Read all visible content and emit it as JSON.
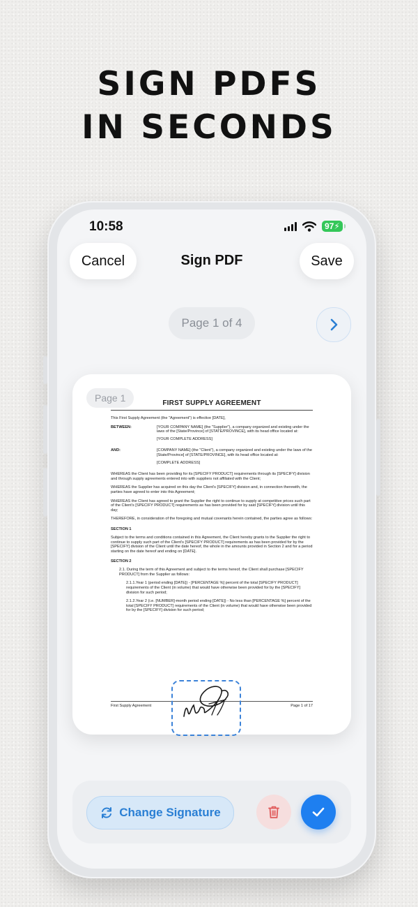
{
  "headline": {
    "line1": "SIGN PDFS",
    "line2": "IN SECONDS"
  },
  "status_bar": {
    "time": "10:58",
    "battery": "97"
  },
  "nav": {
    "cancel": "Cancel",
    "title": "Sign PDF",
    "save": "Save"
  },
  "pager": {
    "indicator": "Page 1 of 4"
  },
  "document": {
    "page_chip": "Page 1",
    "title": "FIRST SUPPLY AGREEMENT",
    "intro": "This First Supply Agreement (the \"Agreement\") is effective [DATE],",
    "between_label": "BETWEEN:",
    "between_text": "[YOUR COMPANY NAME] (the \"Supplier\"), a company organized and existing under the laws of the [State/Province] of [STATE/PROVINCE], with its head office located at:",
    "between_addr": "[YOUR COMPLETE ADDRESS]",
    "and_label": "AND:",
    "and_text": "[COMPANY NAME] (the \"Client\"), a company organized and existing under the laws of the [State/Province] of [STATE/PROVINCE], with its head office located at:",
    "and_addr": "[COMPLETE ADDRESS]",
    "whereas1": "WHEREAS the Client has been providing for its [SPECIFY PRODUCT] requirements through its [SPECIFY] division and through supply agreements entered into with suppliers not affiliated with the Client;",
    "whereas2": "WHEREAS the Supplier has acquired on this day the Client's [SPECIFY] division and, in connection therewith, the parties have agreed to enter into this Agreement;",
    "whereas3": "WHEREAS the Client has agreed to grant the Supplier the right to continue to supply at competitive prices such part of the Client's [SPECIFY PRODUCT] requirements as has been provided for by said [SPECIFY] division until this day;",
    "therefore": "THEREFORE, in consideration of the foregoing and mutual covenants herein contained, the parties agree as follows:",
    "section1": "SECTION 1",
    "section1_text": "Subject to the terms and conditions contained in this Agreement, the Client hereby grants to the Supplier the right to continue to supply such part of the Client's [SPECIFY PRODUCT] requirements as has been provided for by the [SPECIFY] division of the Client until the date hereof, the whole in the amounts provided in Section 2 and for a period starting on the date hereof and ending on [DATE].",
    "section2": "SECTION 2",
    "clause21": "2.1. During the term of this Agreement and subject to the terms hereof, the Client shall purchase [SPECIFY PRODUCT] from the Supplier as follows:",
    "clause211": "2.1.1.Year 1 (period ending [DATE]) - [PERCENTAGE %] percent of the total [SPECIFY PRODUCT] requirements of the Client (in volume) that would have otherwise been provided for by the [SPECIFY] division for such period;",
    "clause212": "2.1.2.Year 2 (i.e. [NUMBER]-month period ending [DATE]) - No less than [PERCENTAGE %] percent of the total [SPECIFY PRODUCT] requirements of the Client (in volume) that would have otherwise been provided for by the [SPECIFY] division for such period;",
    "footer_left": "First Supply Agreement",
    "footer_right": "Page 1 of 17"
  },
  "toolbar": {
    "change_signature": "Change Signature"
  },
  "colors": {
    "accent": "#1e7ff0",
    "battery": "#34c759",
    "delete_bg": "#f6dede",
    "delete_icon": "#e05a5a"
  },
  "icons": [
    "chevron-right-icon",
    "refresh-icon",
    "trash-icon",
    "checkmark-icon",
    "signal-icon",
    "wifi-icon",
    "battery-icon"
  ]
}
